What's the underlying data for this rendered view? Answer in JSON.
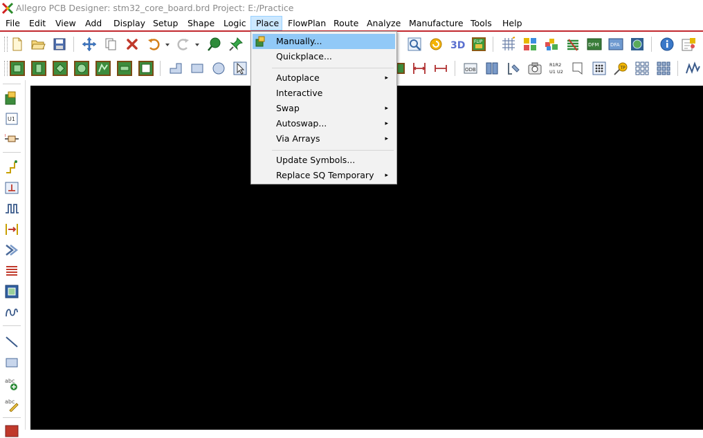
{
  "window": {
    "title": "Allegro PCB Designer: stm32_core_board.brd  Project: E:/Practice"
  },
  "menubar": [
    "File",
    "Edit",
    "View",
    "Add",
    "Display",
    "Setup",
    "Shape",
    "Logic",
    "Place",
    "FlowPlan",
    "Route",
    "Analyze",
    "Manufacture",
    "Tools",
    "Help"
  ],
  "menubar_open": "Place",
  "place_menu": {
    "items": [
      {
        "label": "Manually...",
        "submenu": false,
        "highlighted": true,
        "icon": "place-manual-icon"
      },
      {
        "label": "Quickplace...",
        "submenu": false
      },
      {
        "label": "Autoplace",
        "submenu": true
      },
      {
        "label": "Interactive",
        "submenu": false
      },
      {
        "label": "Swap",
        "submenu": true
      },
      {
        "label": "Autoswap...",
        "submenu": true
      },
      {
        "label": "Via Arrays",
        "submenu": true
      },
      {
        "label": "Update Symbols...",
        "submenu": false
      },
      {
        "label": "Replace SQ Temporary",
        "submenu": true
      }
    ],
    "submenu_arrow": "▸"
  },
  "toolbar_icons_row1": [
    "new-file-icon",
    "open-folder-icon",
    "save-icon",
    "move-icon",
    "copy-icon",
    "delete-icon",
    "undo-icon",
    "redo-icon",
    "add-connect-icon",
    "pin-icon",
    "zoom-fit-icon",
    "refresh-icon",
    "3d-view-icon",
    "flip-icon",
    "grid-icon",
    "color-icon",
    "layer-icon",
    "stackup-icon",
    "dfm-icon",
    "dfa-icon",
    "globe-icon",
    "info-icon",
    "property-icon"
  ],
  "toolbar_icons_row2": [
    "layer-1-icon",
    "layer-2-icon",
    "layer-3-icon",
    "layer-4-icon",
    "layer-5-icon",
    "layer-6-icon",
    "layer-7-icon",
    "step-shape-icon",
    "rect-shape-icon",
    "circle-shape-icon",
    "select-arrow-icon",
    "dim-1-icon",
    "dim-2-icon",
    "odb-icon",
    "book-icon",
    "measure-icon",
    "camera-icon",
    "refdes-icon",
    "note-icon",
    "grid-dots-icon",
    "probe-icon",
    "array-1-icon",
    "array-2-icon",
    "wave-icon"
  ],
  "left_toolbar_icons": [
    "place-comp-icon",
    "refdes-u1-icon",
    "resistor-icon",
    "route-icon",
    "fanout-icon",
    "meander-icon",
    "delay-tune-icon",
    "bus-route-icon",
    "list-icon",
    "board-icon",
    "wave-route-icon",
    "line-icon",
    "rectangle-icon",
    "add-text-icon",
    "edit-text-icon",
    "misc-icon"
  ],
  "colors": {
    "accent_red": "#c1272d",
    "menu_highlight": "#91c9f7",
    "canvas": "#000000"
  }
}
